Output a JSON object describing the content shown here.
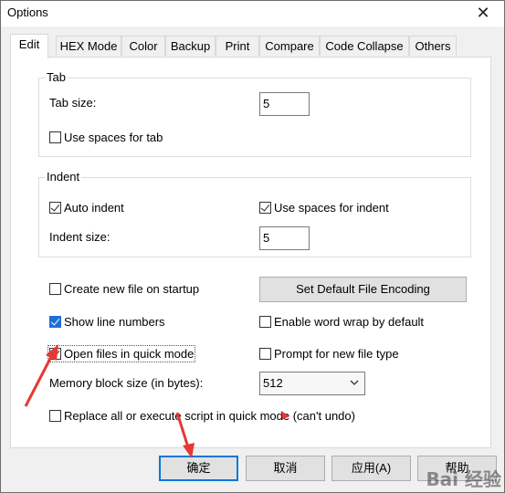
{
  "window": {
    "title": "Options",
    "close_glyph": "✕"
  },
  "tabs": [
    "Edit",
    "HEX Mode",
    "Color",
    "Backup",
    "Print",
    "Compare",
    "Code Collapse",
    "Others"
  ],
  "tab_group": {
    "legend": "Tab",
    "tab_size_label": "Tab size:",
    "tab_size_value": "5",
    "use_spaces_label": "Use spaces for tab",
    "use_spaces_checked": false
  },
  "indent_group": {
    "legend": "Indent",
    "auto_indent_label": "Auto indent",
    "auto_indent_checked": true,
    "use_spaces_indent_label": "Use spaces for indent",
    "use_spaces_indent_checked": true,
    "indent_size_label": "Indent size:",
    "indent_size_value": "5"
  },
  "options": {
    "create_new_file_label": "Create new file on startup",
    "create_new_file_checked": false,
    "set_encoding_button": "Set Default File Encoding",
    "show_line_numbers_label": "Show line numbers",
    "show_line_numbers_checked": true,
    "word_wrap_label": "Enable word wrap by default",
    "word_wrap_checked": false,
    "quick_mode_label": "Open files in quick mode",
    "quick_mode_checked": true,
    "prompt_file_type_label": "Prompt for new file type",
    "prompt_file_type_checked": false,
    "memory_block_label": "Memory block size (in bytes):",
    "memory_block_value": "512",
    "replace_all_label": "Replace all or execute script in quick mode (can't undo)",
    "replace_all_checked": false
  },
  "footer": {
    "ok": "确定",
    "cancel": "取消",
    "apply": "应用(A)",
    "help": "帮助"
  },
  "colors": {
    "accent": "#0078d7",
    "annotation_arrow": "#e53935"
  }
}
